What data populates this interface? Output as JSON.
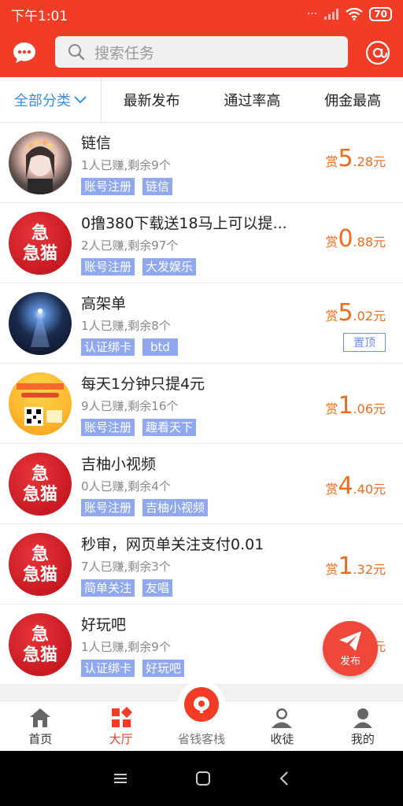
{
  "status": {
    "time": "下午1:01",
    "battery": "70",
    "dots": "···"
  },
  "search": {
    "placeholder": "搜索任务"
  },
  "filters": [
    {
      "label": "全部分类"
    },
    {
      "label": "最新发布"
    },
    {
      "label": "通过率高"
    },
    {
      "label": "佣金最高"
    }
  ],
  "avatar_text": {
    "line1": "急",
    "line2": "急猫"
  },
  "tasks": [
    {
      "title": "链信",
      "meta": "1人已赚,剩余9个",
      "tags": [
        "账号注册",
        "链信"
      ],
      "reward_prefix": "赏",
      "reward_int": "5",
      "reward_dec": ".28元"
    },
    {
      "title": "0撸380下载送18马上可以提...",
      "meta": "2人已赚,剩余97个",
      "tags": [
        "账号注册",
        "大发娱乐"
      ],
      "reward_prefix": "赏",
      "reward_int": "0",
      "reward_dec": ".88元"
    },
    {
      "title": "高架单",
      "meta": "1人已赚,剩余8个",
      "tags": [
        "认证绑卡",
        "btd"
      ],
      "reward_prefix": "赏",
      "reward_int": "5",
      "reward_dec": ".02元",
      "badge": "置顶"
    },
    {
      "title": "每天1分钟只提4元",
      "meta": "9人已赚,剩余16个",
      "tags": [
        "账号注册",
        "趣看天下"
      ],
      "reward_prefix": "赏",
      "reward_int": "1",
      "reward_dec": ".06元"
    },
    {
      "title": "吉柚小视频",
      "meta": "0人已赚,剩余4个",
      "tags": [
        "账号注册",
        "吉柚小视频"
      ],
      "reward_prefix": "赏",
      "reward_int": "4",
      "reward_dec": ".40元"
    },
    {
      "title": "秒审，网页单关注支付0.01",
      "meta": "7人已赚,剩余3个",
      "tags": [
        "简单关注",
        "友唱"
      ],
      "reward_prefix": "赏",
      "reward_int": "1",
      "reward_dec": ".32元"
    },
    {
      "title": "好玩吧",
      "meta": "1人已赚,剩余9个",
      "tags": [
        "认证绑卡",
        "好玩吧"
      ],
      "reward_prefix": "赏",
      "reward_int": "",
      "reward_dec": "元"
    }
  ],
  "fab": {
    "label": "发布"
  },
  "tabs": [
    {
      "label": "首页"
    },
    {
      "label": "大厅"
    },
    {
      "label": "省钱客栈"
    },
    {
      "label": "收徒"
    },
    {
      "label": "我的"
    }
  ]
}
